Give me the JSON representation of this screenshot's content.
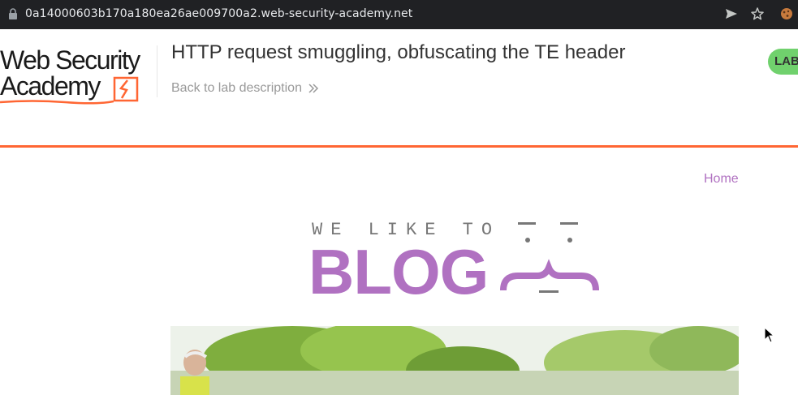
{
  "browser": {
    "url": "0a14000603b170a180ea26ae009700a2.web-security-academy.net",
    "icons": [
      "lock-icon",
      "send-icon",
      "star-icon",
      "cookie-extension-icon"
    ]
  },
  "lab_header": {
    "logo_line1": "Web Security",
    "logo_line2": "Academy",
    "title": "HTTP request smuggling, obfuscating the TE header",
    "back_link": "Back to lab description",
    "status_badge": "LAB",
    "accent_color": "#ff6633",
    "badge_color": "#70d16d"
  },
  "blog": {
    "nav": {
      "home_label": "Home"
    },
    "tagline": "WE LIKE TO",
    "wordmark": "BLOG",
    "brand_color": "#b071c1"
  }
}
